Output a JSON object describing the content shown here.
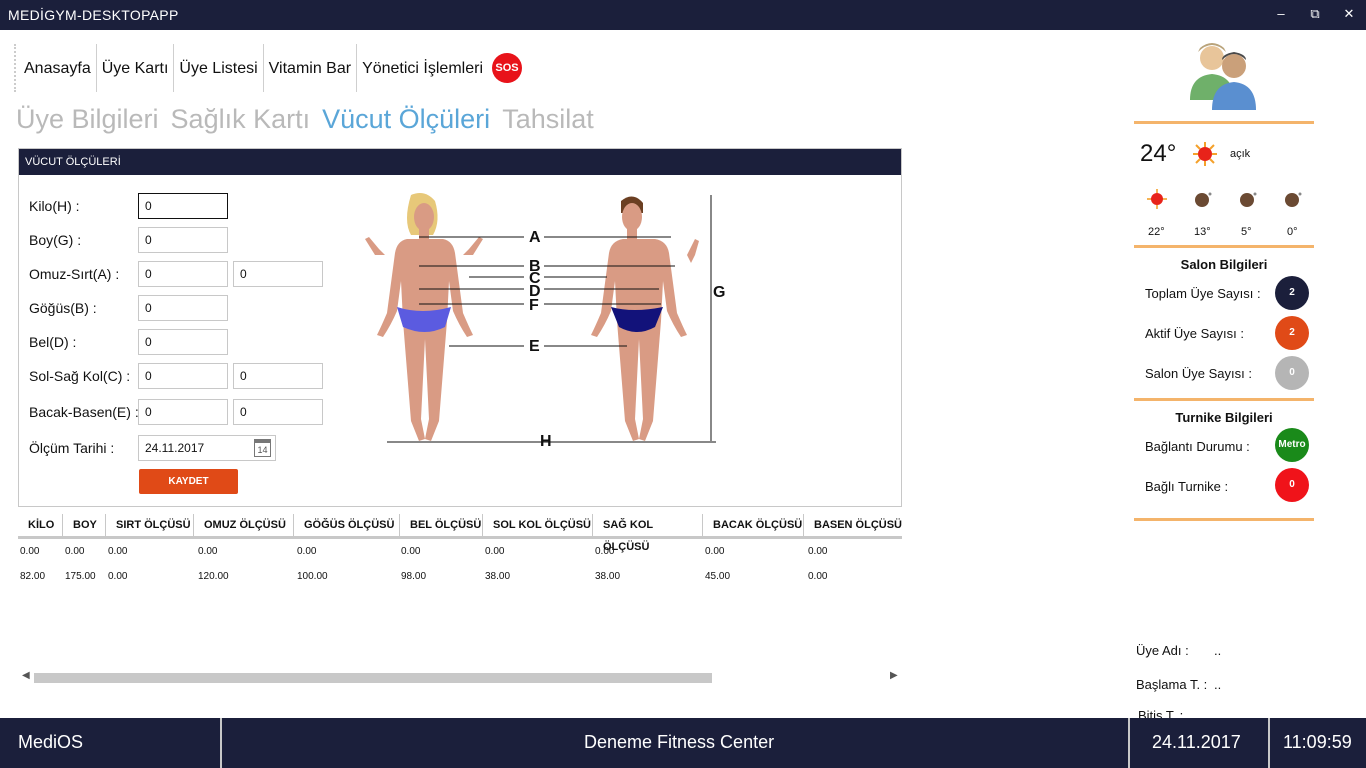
{
  "window": {
    "title": "MEDİGYM-DESKTOPAPP",
    "controls": {
      "minimize": "–",
      "restore": "⧉",
      "close": "✕"
    }
  },
  "menu": {
    "items": [
      "Anasayfa",
      "Üye Kartı",
      "Üye Listesi",
      "Vitamin Bar",
      "Yönetici İşlemleri"
    ],
    "sos_label": "SOS"
  },
  "tabs": [
    {
      "label": "Üye Bilgileri",
      "active": false
    },
    {
      "label": "Sağlık Kartı",
      "active": false
    },
    {
      "label": "Vücut Ölçüleri",
      "active": true
    },
    {
      "label": "Tahsilat",
      "active": false
    }
  ],
  "form": {
    "header": "VÜCUT ÖLÇÜLERİ",
    "fields": [
      {
        "label": "Kilo(H) :",
        "values": [
          "0"
        ]
      },
      {
        "label": "Boy(G) :",
        "values": [
          "0"
        ]
      },
      {
        "label": "Omuz-Sırt(A) :",
        "values": [
          "0",
          "0"
        ]
      },
      {
        "label": "Göğüs(B) :",
        "values": [
          "0"
        ]
      },
      {
        "label": "Bel(D) :",
        "values": [
          "0"
        ]
      },
      {
        "label": "Sol-Sağ Kol(C) :",
        "values": [
          "0",
          "0"
        ]
      },
      {
        "label": "Bacak-Basen(E) :",
        "values": [
          "0",
          "0"
        ]
      }
    ],
    "date_label": "Ölçüm Tarihi :",
    "date_value": "24.11.2017",
    "calendar_day": "14",
    "save_label": "KAYDET",
    "figure_labels": [
      "A",
      "B",
      "C",
      "D",
      "F",
      "E",
      "G",
      "H"
    ]
  },
  "table": {
    "columns": [
      "KİLO",
      "BOY",
      "SIRT ÖLÇÜSÜ",
      "OMUZ ÖLÇÜSÜ",
      "GÖĞÜS ÖLÇÜSÜ",
      "BEL ÖLÇÜSÜ",
      "SOL KOL ÖLÇÜSÜ",
      "SAĞ KOL ÖLÇÜSÜ",
      "BACAK ÖLÇÜSÜ",
      "BASEN ÖLÇÜSÜ"
    ],
    "rows": [
      [
        "0.00",
        "0.00",
        "0.00",
        "0.00",
        "0.00",
        "0.00",
        "0.00",
        "0.00",
        "0.00",
        "0.00"
      ],
      [
        "82.00",
        "175.00",
        "0.00",
        "120.00",
        "100.00",
        "98.00",
        "38.00",
        "38.00",
        "45.00",
        "0.00"
      ]
    ]
  },
  "weather": {
    "temp": "24°",
    "condition": "açık",
    "forecast": [
      "22°",
      "13°",
      "5°",
      "0°"
    ]
  },
  "salon": {
    "title": "Salon Bilgileri",
    "stats": [
      {
        "label": "Toplam Üye Sayısı :",
        "value": "2",
        "color": "#1b1f3b"
      },
      {
        "label": "Aktif Üye Sayısı :",
        "value": "2",
        "color": "#e04a17"
      },
      {
        "label": "Salon Üye Sayısı :",
        "value": "0",
        "color": "#b5b5b5"
      }
    ]
  },
  "turnike": {
    "title": "Turnike Bilgileri",
    "stats": [
      {
        "label": "Bağlantı Durumu :",
        "value": "Metro",
        "color": "#1a8a1a"
      },
      {
        "label": "Bağlı Turnike :",
        "value": "0",
        "color": "#f0131a"
      }
    ]
  },
  "member": {
    "name_label": "Üye Adı :",
    "name_value": "..",
    "start_label": "Başlama T. :",
    "start_value": "..",
    "end_label": "Bitiş T. :"
  },
  "status": {
    "os": "MediOS",
    "center": "Deneme Fitness Center",
    "date": "24.11.2017",
    "time": "11:09:59"
  }
}
